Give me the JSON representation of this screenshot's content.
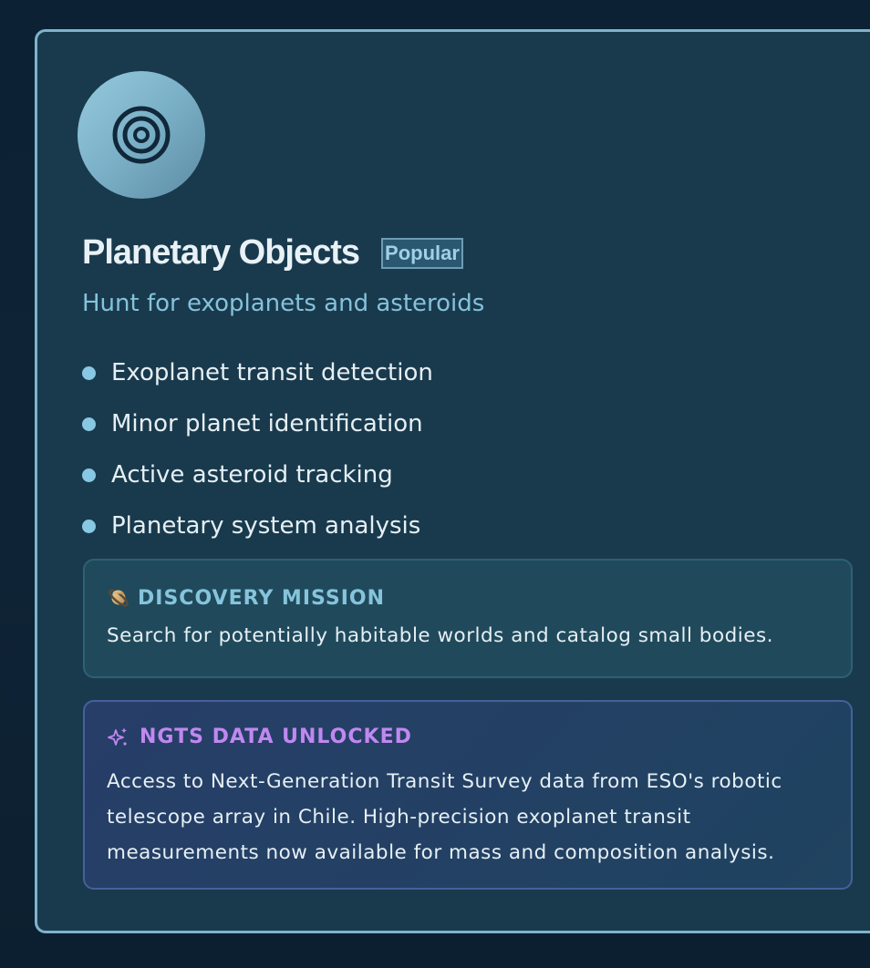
{
  "card": {
    "avatar_icon": "target-rings-icon",
    "title": "Planetary Objects",
    "badge": "Popular",
    "subtitle": "Hunt for exoplanets and asteroids",
    "features": [
      {
        "label": "Exoplanet transit detection"
      },
      {
        "label": "Minor planet identification"
      },
      {
        "label": "Active asteroid tracking"
      },
      {
        "label": "Planetary system analysis"
      }
    ],
    "mission": {
      "icon": "ringed-planet-icon",
      "title": "DISCOVERY MISSION",
      "text": "Search for potentially habitable worlds and catalog small bodies."
    },
    "unlock": {
      "icon": "sparkles-icon",
      "title": "NGTS DATA UNLOCKED",
      "text": "Access to Next-Generation Transit Survey data from ESO's robotic telescope array in Chile. High-precision exoplanet transit measurements now available for mass and composition analysis."
    }
  },
  "colors": {
    "accent": "#86c4dc",
    "unlock_accent": "#c088f0",
    "card_border": "#7fb3cc",
    "card_bg": "#193a4d"
  }
}
